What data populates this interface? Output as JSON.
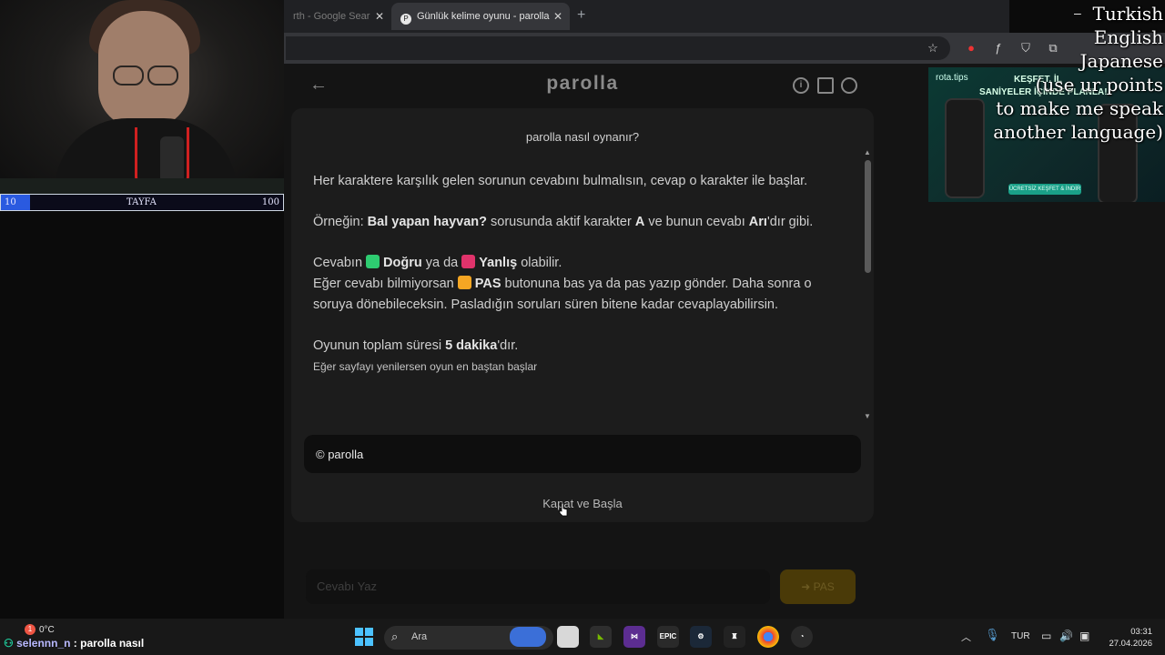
{
  "overlay": {
    "xp": {
      "left": "10",
      "name": "TAYFA",
      "right": "100"
    },
    "languages": [
      "Turkish",
      "English",
      "Japanese",
      "(use ur points",
      "to make me speak",
      "another language)"
    ],
    "minimize": "–"
  },
  "browser": {
    "tabs": [
      {
        "label": "rth - Google Sear",
        "close": "✕"
      },
      {
        "label": "Günlük kelime oyunu - parolla",
        "favicon": "P",
        "close": "✕"
      }
    ],
    "new_tab": "+"
  },
  "page": {
    "back": "←",
    "brand": "parolla",
    "header_icons": [
      "info-icon",
      "stats-icon",
      "profile-icon"
    ]
  },
  "ad": {
    "brand": "rota.tips",
    "headline": "KEŞFET. İL",
    "headline2": "SANİYELER İÇİNDE PLANLA!",
    "cta": "ÜCRETSİZ KEŞFET & İNDİR"
  },
  "modal": {
    "title": "parolla nasıl oynanır?",
    "p1": "Her karaktere karşılık gelen sorunun cevabını bulmalısın, cevap o karakter ile başlar.",
    "p2_a": "Örneğin: ",
    "p2_b": "Bal yapan hayvan?",
    "p2_c": " sorusunda aktif karakter ",
    "p2_d": "A",
    "p2_e": " ve bunun cevabı ",
    "p2_f": "Arı",
    "p2_g": "'dır gibi.",
    "p3_a": "Cevabın ",
    "p3_b": "Doğru",
    "p3_c": " ya da ",
    "p3_d": "Yanlış",
    "p3_e": " olabilir.",
    "p3_f": "Eğer cevabı bilmiyorsan ",
    "p3_g": "PAS",
    "p3_h": " butonuna bas ya da pas yazıp gönder. Daha sonra o soruya dönebileceksin. Pasladığın soruları süren bitene kadar cevaplayabilirsin.",
    "p4_a": "Oyunun toplam süresi ",
    "p4_b": "5 dakika",
    "p4_c": "'dır.",
    "p4_note": "Eğer sayfayı yenilersen oyun en baştan başlar",
    "footer": "© parolla",
    "button": "Kapat ve Başla",
    "colors": {
      "correct": "#2ecc71",
      "wrong": "#e0336b",
      "pass": "#f5a623"
    }
  },
  "game": {
    "input_placeholder": "Cevabı Yaz",
    "pas_label": "➜ PAS"
  },
  "taskbar": {
    "weather_temp": "0°C",
    "weather_badge": "1",
    "chat_user": "selennn_n",
    "chat_sep": " : ",
    "chat_msg": "parolla nasıl",
    "search_label": "Ara",
    "lang": "TUR",
    "time": "03:31",
    "date": "27.04.2026"
  }
}
